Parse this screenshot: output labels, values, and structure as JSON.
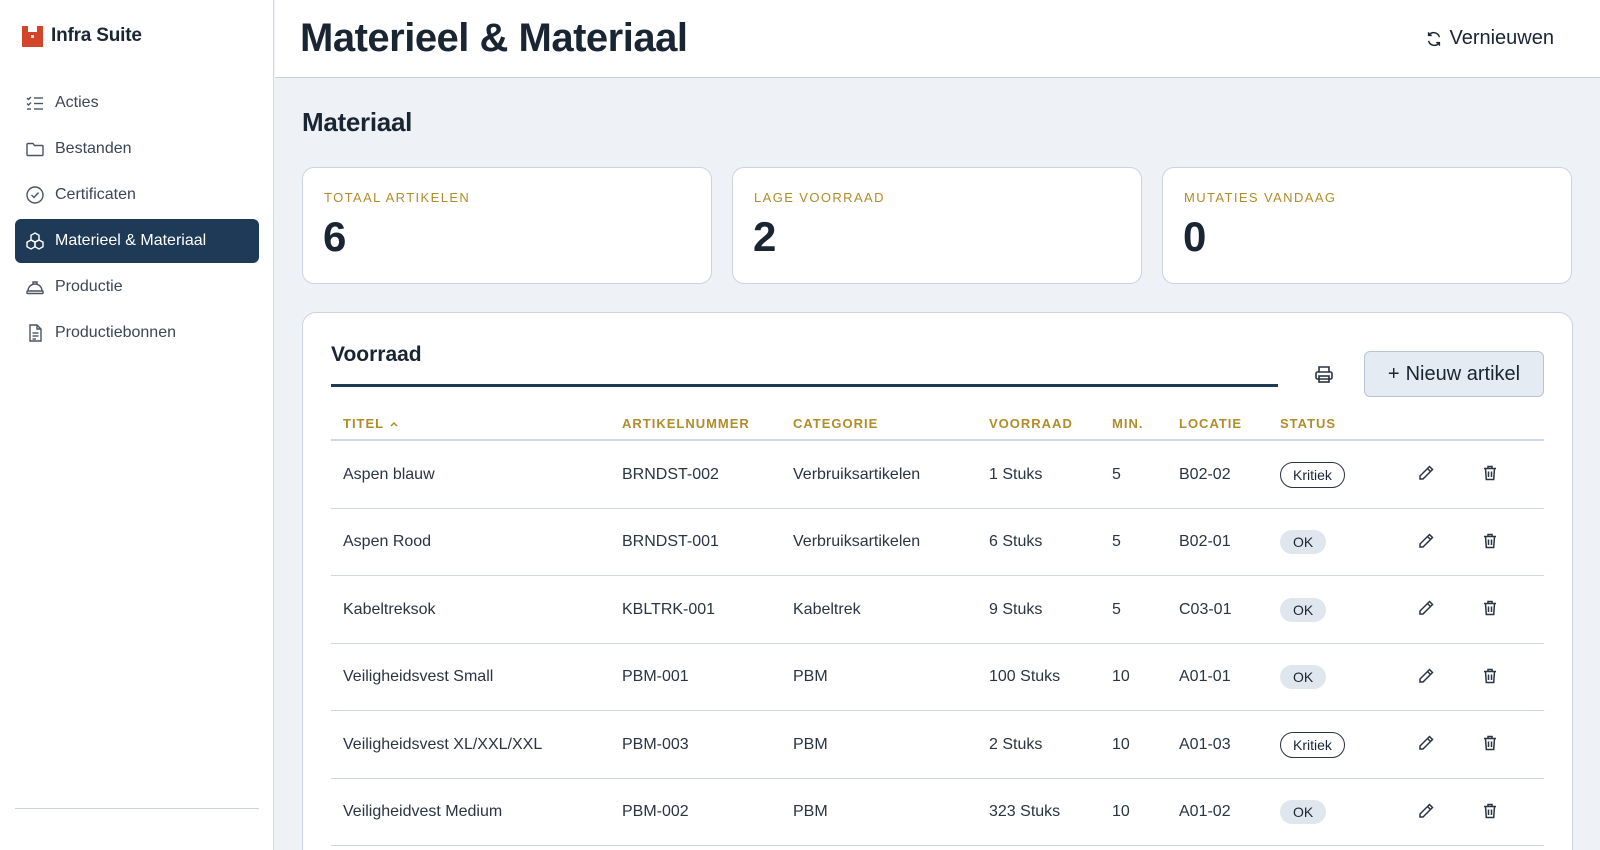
{
  "app": {
    "name": "Infra Suite"
  },
  "sidebar": {
    "items": [
      {
        "label": "Acties",
        "icon": "checklist-icon",
        "active": false
      },
      {
        "label": "Bestanden",
        "icon": "folder-icon",
        "active": false
      },
      {
        "label": "Certificaten",
        "icon": "check-circle-icon",
        "active": false
      },
      {
        "label": "Materieel & Materiaal",
        "icon": "boxes-icon",
        "active": true
      },
      {
        "label": "Productie",
        "icon": "hardhat-icon",
        "active": false
      },
      {
        "label": "Productiebonnen",
        "icon": "document-icon",
        "active": false
      }
    ]
  },
  "header": {
    "title": "Materieel & Materiaal",
    "refresh_label": "Vernieuwen"
  },
  "section": {
    "title": "Materiaal"
  },
  "stats": [
    {
      "label": "TOTAAL ARTIKELEN",
      "value": "6"
    },
    {
      "label": "LAGE VOORRAAD",
      "value": "2"
    },
    {
      "label": "MUTATIES VANDAAG",
      "value": "0"
    }
  ],
  "panel": {
    "tab": "Voorraad",
    "new_label": "Nieuw artikel"
  },
  "table": {
    "columns": [
      "TITEL",
      "ARTIKELNUMMER",
      "CATEGORIE",
      "VOORRAAD",
      "MIN.",
      "LOCATIE",
      "STATUS"
    ],
    "rows": [
      {
        "titel": "Aspen blauw",
        "artikelnummer": "BRNDST-002",
        "categorie": "Verbruiksartikelen",
        "voorraad": "1 Stuks",
        "min": "5",
        "locatie": "B02-02",
        "status": "Kritiek"
      },
      {
        "titel": "Aspen Rood",
        "artikelnummer": "BRNDST-001",
        "categorie": "Verbruiksartikelen",
        "voorraad": "6 Stuks",
        "min": "5",
        "locatie": "B02-01",
        "status": "OK"
      },
      {
        "titel": "Kabeltreksok",
        "artikelnummer": "KBLTRK-001",
        "categorie": "Kabeltrek",
        "voorraad": "9 Stuks",
        "min": "5",
        "locatie": "C03-01",
        "status": "OK"
      },
      {
        "titel": "Veiligheidsvest Small",
        "artikelnummer": "PBM-001",
        "categorie": "PBM",
        "voorraad": "100 Stuks",
        "min": "10",
        "locatie": "A01-01",
        "status": "OK"
      },
      {
        "titel": "Veiligheidsvest XL/XXL/XXL",
        "artikelnummer": "PBM-003",
        "categorie": "PBM",
        "voorraad": "2 Stuks",
        "min": "10",
        "locatie": "A01-03",
        "status": "Kritiek"
      },
      {
        "titel": "Veiligheidvest Medium",
        "artikelnummer": "PBM-002",
        "categorie": "PBM",
        "voorraad": "323 Stuks",
        "min": "10",
        "locatie": "A01-02",
        "status": "OK"
      }
    ]
  },
  "colors": {
    "accent": "#1f3a57",
    "label_gold": "#b08c2a",
    "logo_red": "#d2452a"
  }
}
